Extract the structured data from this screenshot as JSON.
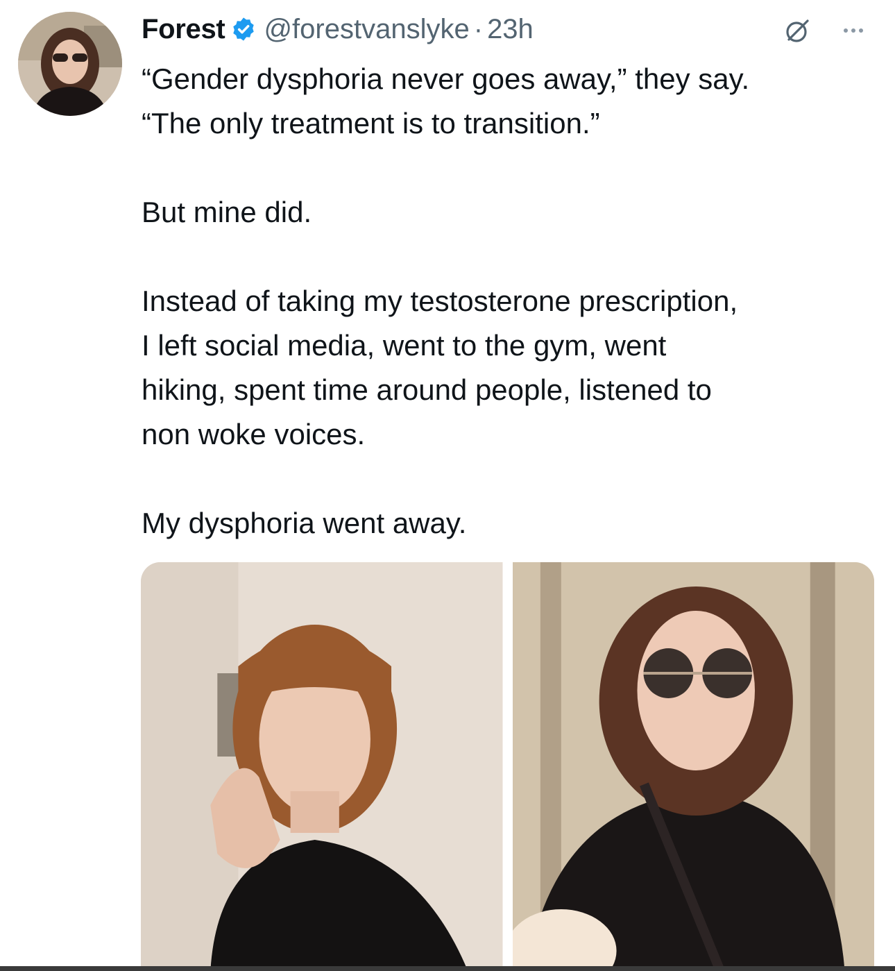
{
  "post": {
    "author": {
      "display_name": "Forest",
      "handle": "@forestvanslyke",
      "separator": "·",
      "time": "23h",
      "verified": true
    },
    "paragraphs": [
      [
        "“Gender dysphoria never goes away,” they say.",
        "“The only treatment is to transition.”"
      ],
      [
        "But mine did."
      ],
      [
        "Instead of taking my testosterone prescription,",
        "I left social media, went to the gym, went",
        "hiking, spent time around people, listened to",
        "non woke voices."
      ],
      [
        "My dysphoria went away."
      ]
    ],
    "media": [
      {
        "name": "photo-before"
      },
      {
        "name": "photo-after"
      }
    ]
  },
  "icons": {
    "verified": "verified-badge-icon",
    "grok": "grok-icon",
    "more": "more-options-icon"
  },
  "colors": {
    "text": "#0f1419",
    "secondary": "#536471",
    "verified": "#1d9bf0"
  }
}
